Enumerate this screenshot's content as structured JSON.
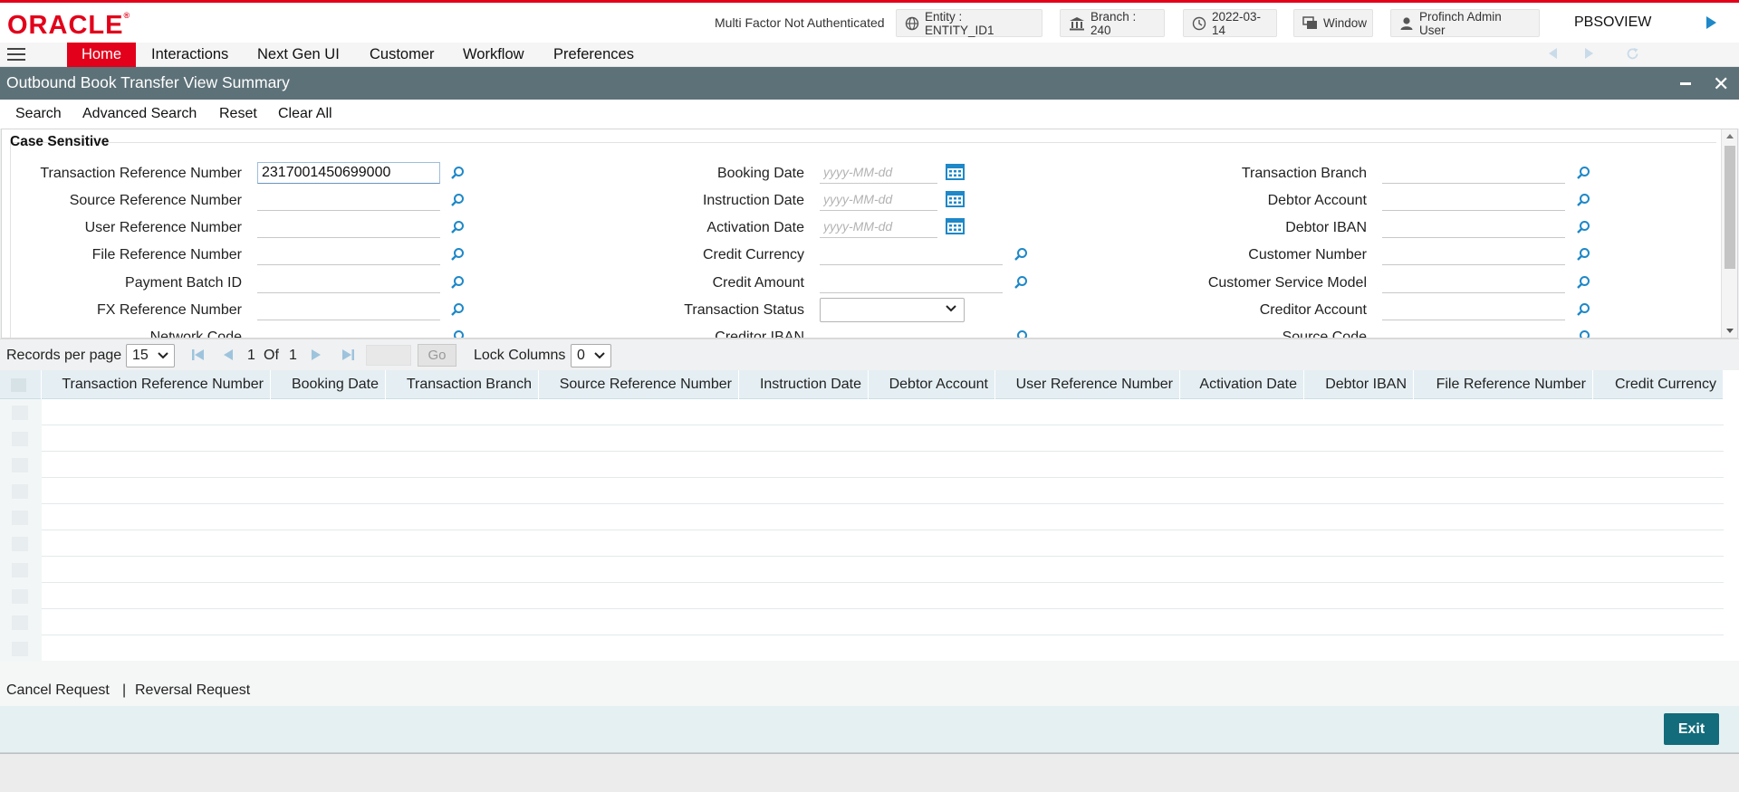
{
  "header": {
    "logo": "ORACLE",
    "auth_status": "Multi Factor Not Authenticated",
    "entity": "Entity : ENTITY_ID1",
    "branch": "Branch : 240",
    "date": "2022-03-14",
    "window": "Window",
    "user": "Profinch Admin User",
    "function_id": "PBSOVIEW"
  },
  "menu": [
    "Home",
    "Interactions",
    "Next Gen UI",
    "Customer",
    "Workflow",
    "Preferences"
  ],
  "title": "Outbound Book Transfer View Summary",
  "toolbar": {
    "search": "Search",
    "advanced_search": "Advanced Search",
    "reset": "Reset",
    "clear_all": "Clear All"
  },
  "section_title": "Case Sensitive",
  "fields": {
    "col1": [
      {
        "label": "Transaction Reference Number",
        "value": "2317001450699000"
      },
      {
        "label": "Source Reference Number",
        "value": ""
      },
      {
        "label": "User Reference Number",
        "value": ""
      },
      {
        "label": "File Reference Number",
        "value": ""
      },
      {
        "label": "Payment Batch ID",
        "value": ""
      },
      {
        "label": "FX Reference Number",
        "value": ""
      },
      {
        "label": "Network Code",
        "value": ""
      }
    ],
    "col2": [
      {
        "label": "Booking Date",
        "placeholder": "yyyy-MM-dd"
      },
      {
        "label": "Instruction Date",
        "placeholder": "yyyy-MM-dd"
      },
      {
        "label": "Activation Date",
        "placeholder": "yyyy-MM-dd"
      },
      {
        "label": "Credit Currency",
        "value": ""
      },
      {
        "label": "Credit Amount",
        "value": ""
      },
      {
        "label": "Transaction Status",
        "value": ""
      },
      {
        "label": "Creditor IBAN",
        "value": ""
      }
    ],
    "col3": [
      {
        "label": "Transaction Branch",
        "value": ""
      },
      {
        "label": "Debtor Account",
        "value": ""
      },
      {
        "label": "Debtor IBAN",
        "value": ""
      },
      {
        "label": "Customer Number",
        "value": ""
      },
      {
        "label": "Customer Service Model",
        "value": ""
      },
      {
        "label": "Creditor Account",
        "value": ""
      },
      {
        "label": "Source Code",
        "value": ""
      }
    ]
  },
  "pager": {
    "records_per_page_label": "Records per page",
    "records_per_page": "15",
    "current_page": "1",
    "of_label": "Of",
    "total_pages": "1",
    "go": "Go",
    "lock_columns_label": "Lock Columns",
    "lock_columns": "0"
  },
  "grid": {
    "columns": [
      "Transaction Reference Number",
      "Booking Date",
      "Transaction Branch",
      "Source Reference Number",
      "Instruction Date",
      "Debtor Account",
      "User Reference Number",
      "Activation Date",
      "Debtor IBAN",
      "File Reference Number",
      "Credit Currency"
    ]
  },
  "bottom_actions": {
    "cancel": "Cancel Request",
    "separator": "|",
    "reversal": "Reversal Request"
  },
  "footer": {
    "exit": "Exit"
  },
  "colors": {
    "brand_red": "#e2001a",
    "title_bar": "#5d7178",
    "accent_blue": "#1e88c8",
    "exit_button": "#126c7b"
  }
}
